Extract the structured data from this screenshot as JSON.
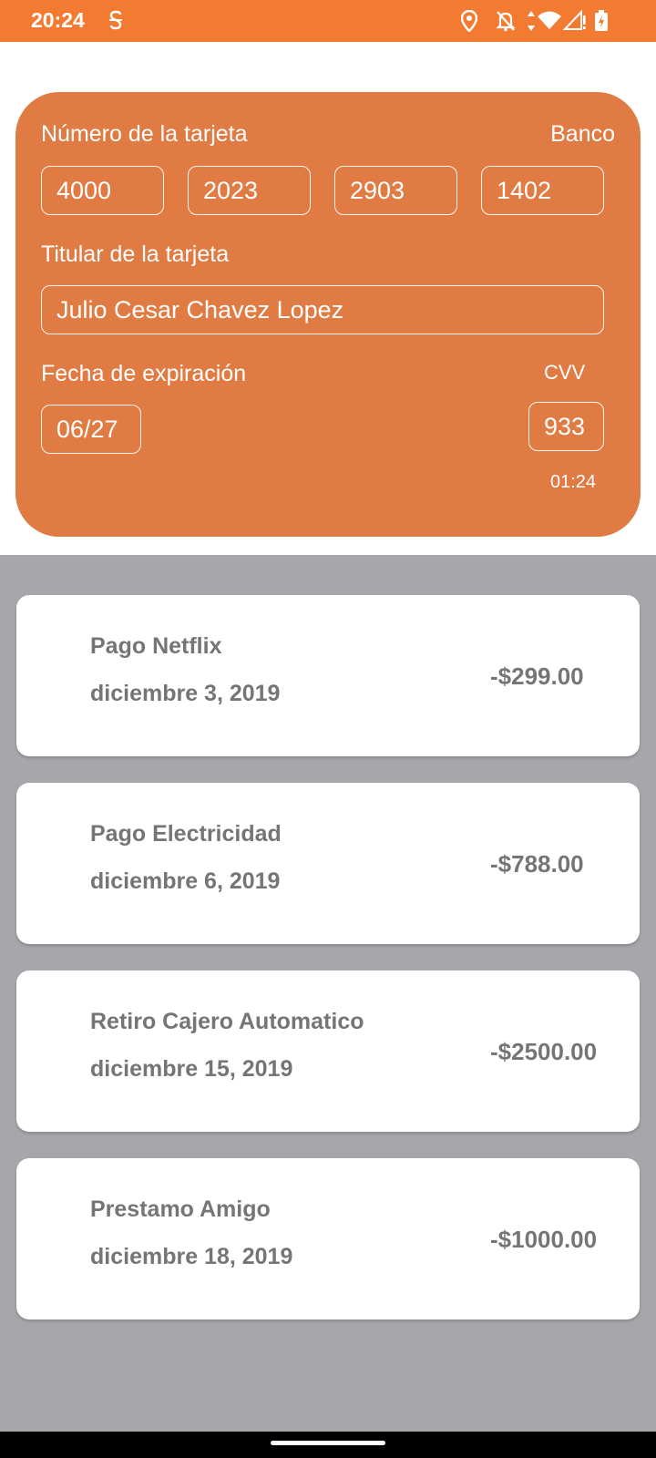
{
  "status_bar": {
    "time": "20:24",
    "icons": [
      "sim-toolkit-icon",
      "location-icon",
      "notifications-off-icon",
      "data-arrows-icon",
      "wifi-icon",
      "signal-icon",
      "battery-charging-icon"
    ],
    "background": "#f37b31"
  },
  "card": {
    "background": "#e07b43",
    "number_label": "Número de la tarjeta",
    "bank_label": "Banco",
    "number_groups": [
      "4000",
      "2023",
      "2903",
      "1402"
    ],
    "holder_label": "Titular de la tarjeta",
    "holder_name": "Julio Cesar Chavez Lopez",
    "expiry_label": "Fecha de expiración",
    "expiry_value": "06/27",
    "cvv_label": "CVV",
    "cvv_value": "933",
    "cvv_timer": "01:24"
  },
  "transactions": [
    {
      "title": "Pago Netflix",
      "date": "diciembre 3, 2019",
      "amount": "-$299.00"
    },
    {
      "title": "Pago Electricidad",
      "date": "diciembre 6, 2019",
      "amount": "-$788.00"
    },
    {
      "title": "Retiro Cajero Automatico",
      "date": "diciembre 15, 2019",
      "amount": "-$2500.00"
    },
    {
      "title": "Prestamo Amigo",
      "date": "diciembre 18, 2019",
      "amount": "-$1000.00"
    }
  ],
  "colors": {
    "accent": "#f37b31",
    "list_background": "#a6a6ab",
    "text_muted": "#757575"
  }
}
